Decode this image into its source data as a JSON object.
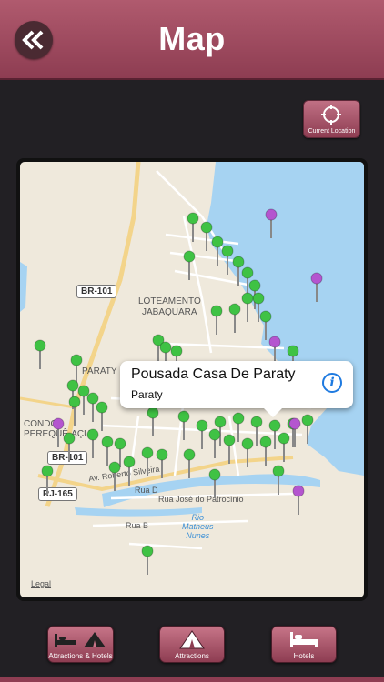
{
  "header": {
    "title": "Map",
    "back_icon": "double-chevron-left-icon"
  },
  "current_location": {
    "label": "Current Location",
    "icon": "crosshair-icon"
  },
  "map": {
    "labels": {
      "loteamento": "LOTEAMENTO",
      "jabaquara": "JABAQUARA",
      "paraty": "PARATY",
      "condominio": "CONDO",
      "perequeacu": "PEREQUÊ-AÇU",
      "legal": "Legal"
    },
    "shields": {
      "br101_top": "BR-101",
      "br101_bottom": "BR-101",
      "rj165": "RJ-165"
    },
    "roads": {
      "roberto": "Av. Roberto Silveira",
      "rua_d": "Rua D",
      "jose": "Rua José do Patrocínio",
      "rua_b": "Rua B"
    },
    "water": {
      "rio": "Rio",
      "matheus": "Matheus",
      "nunes": "Nunes"
    },
    "colors": {
      "land": "#efe9dc",
      "water": "#a6d3f2",
      "road": "#ffffff",
      "highway": "#f3d48a",
      "pin_green": "#3fc244",
      "pin_purple": "#b455cf"
    }
  },
  "callout": {
    "title": "Pousada Casa De Paraty",
    "subtitle": "Paraty",
    "info_icon": "info-icon"
  },
  "tabs": [
    {
      "label": "Attractions & Hotels",
      "icon": "bed-tent-icon"
    },
    {
      "label": "Attractions",
      "icon": "tent-icon"
    },
    {
      "label": "Hotels",
      "icon": "bed-icon"
    }
  ]
}
